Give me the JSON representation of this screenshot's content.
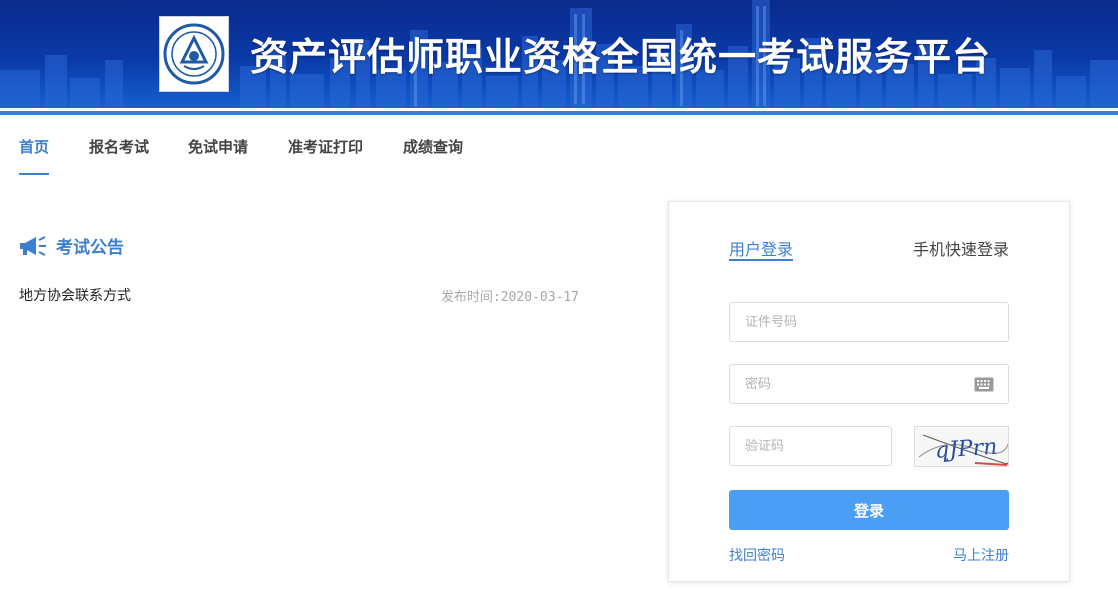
{
  "header": {
    "title": "资产评估师职业资格全国统一考试服务平台",
    "logo_icon": "china-appraisal-society-logo-icon",
    "colors": {
      "banner_dark": "#0b2a8c",
      "banner_light": "#1560d0"
    }
  },
  "nav": {
    "items": [
      {
        "label": "首页",
        "active": true
      },
      {
        "label": "报名考试"
      },
      {
        "label": "免试申请"
      },
      {
        "label": "准考证打印"
      },
      {
        "label": "成绩查询"
      }
    ],
    "accent_color": "#3d7fcf"
  },
  "notice": {
    "title": "考试公告",
    "icon": "megaphone-icon",
    "items": [
      {
        "title": "地方协会联系方式",
        "time": "发布时间:2020-03-17"
      }
    ]
  },
  "login": {
    "tabs": {
      "user": "用户登录",
      "phone": "手机快速登录"
    },
    "id_placeholder": "证件号码",
    "password_placeholder": "密码",
    "captcha_placeholder": "验证码",
    "submit_label": "登录",
    "forgot_label": "找回密码",
    "register_label": "马上注册",
    "button_color": "#4a9ff5"
  }
}
